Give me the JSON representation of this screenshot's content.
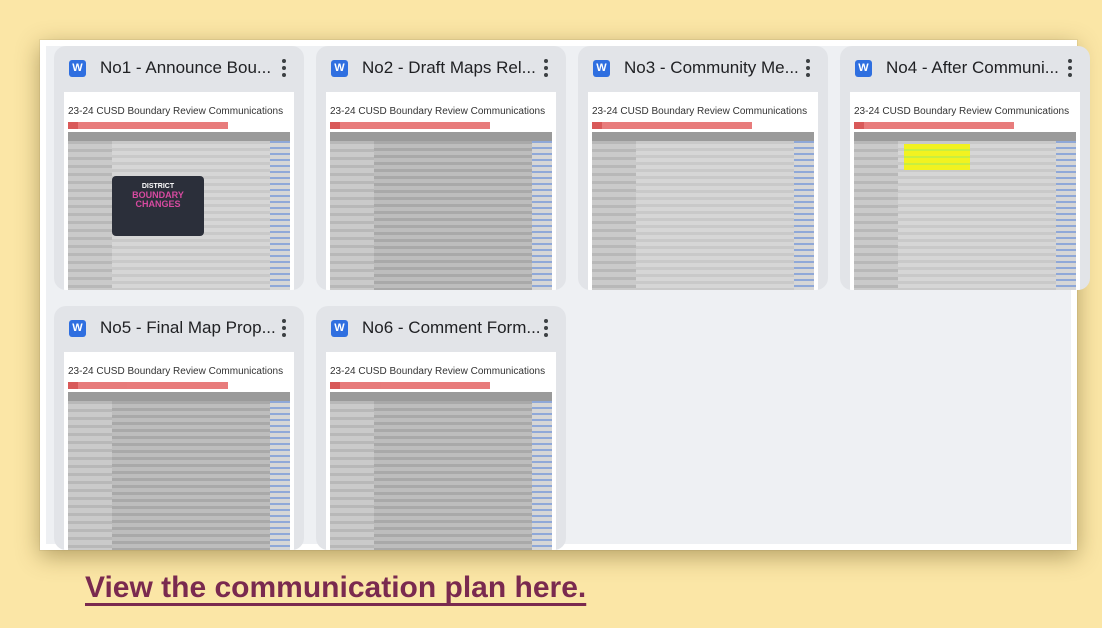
{
  "docs": {
    "doc_heading": "23-24 CUSD Boundary Review Communications",
    "items": [
      {
        "title": "No1 - Announce Bou..."
      },
      {
        "title": "No2 - Draft Maps Rel..."
      },
      {
        "title": "No3 - Community Me..."
      },
      {
        "title": "No4 - After Communi..."
      },
      {
        "title": "No5 - Final Map Prop..."
      },
      {
        "title": "No6 - Comment Form..."
      }
    ],
    "file_icon_letter": "W",
    "icon_color": "#2f6fe0"
  },
  "banner_graphic": {
    "line1": "DISTRICT",
    "line2": "BOUNDARY CHANGES"
  },
  "footer": {
    "link_text": "View the communication plan here.",
    "link_color": "#7a2a4f"
  },
  "colors": {
    "background": "#fbe6a6",
    "card": "#e2e4e8",
    "section_heading_red": "#e05050",
    "highlight_yellow": "#f2f220"
  }
}
